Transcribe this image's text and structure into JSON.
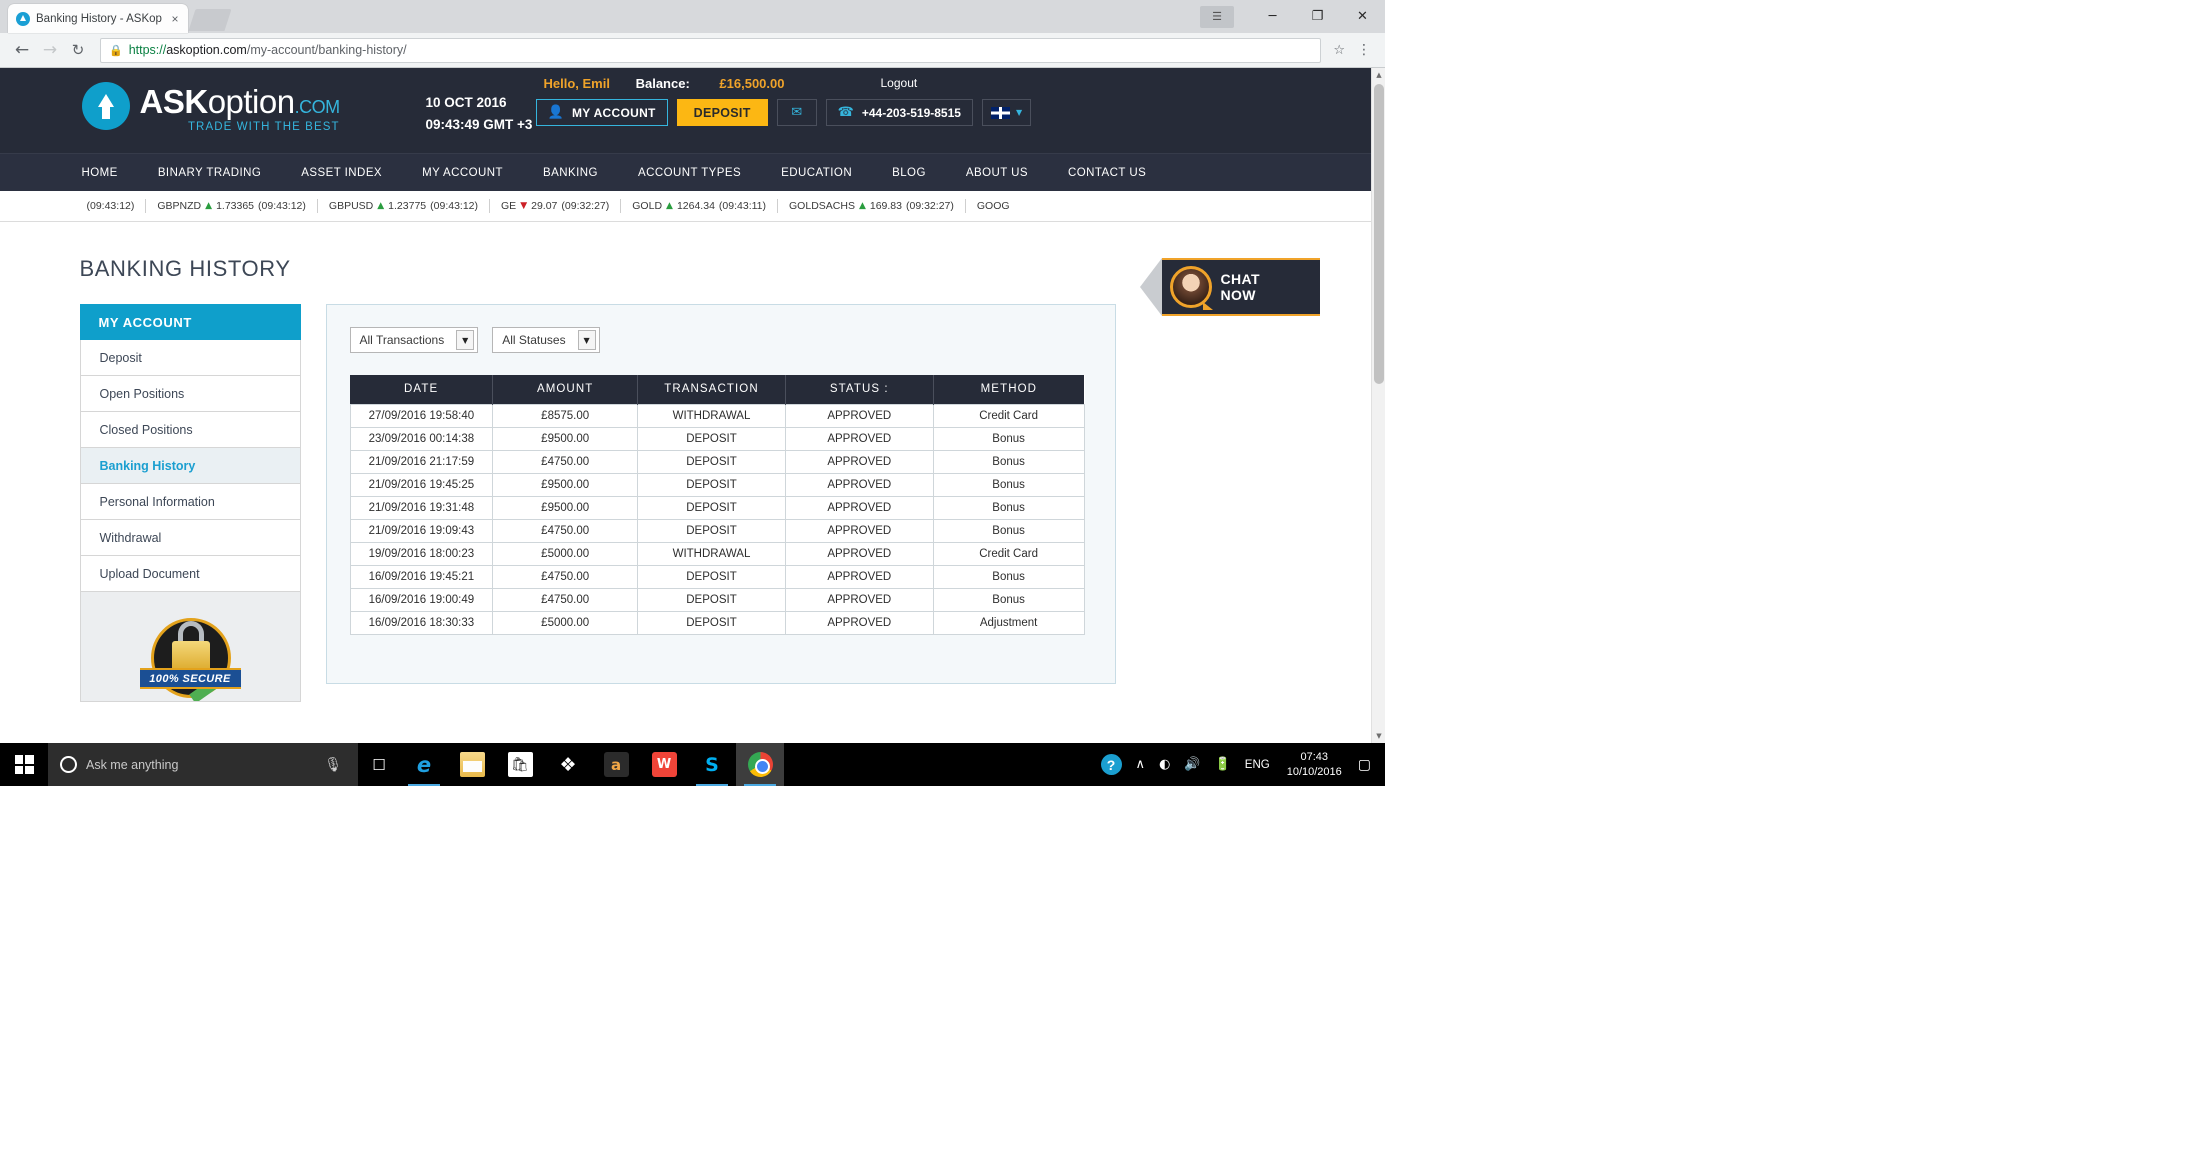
{
  "browser": {
    "tab": {
      "title": "Banking History - ASKop",
      "favicon": "askoption-favicon",
      "close": "×"
    },
    "window_controls": {
      "restore_small": "☰",
      "minimize": "─",
      "maximize": "❐",
      "close": "✕"
    },
    "nav": {
      "back": "←",
      "forward": "→",
      "reload": "↻",
      "star": "☆",
      "menu": "⋮"
    },
    "url": {
      "lock": "🔒",
      "scheme": "https://",
      "host": "askoption.com",
      "path": "/my-account/banking-history/"
    },
    "scrollbar": {
      "up": "▲",
      "down": "▼"
    }
  },
  "site": {
    "logo": {
      "ask": "ASK",
      "option": "option",
      "dotcom": ".COM",
      "tagline": "TRADE WITH THE BEST"
    },
    "date_line1": "10 OCT 2016",
    "date_line2": "09:43:49 GMT +3",
    "greeting": "Hello, Emil",
    "balance_label": "Balance:",
    "balance_value": "£16,500.00",
    "logout": "Logout",
    "buttons": {
      "my_account": "MY ACCOUNT",
      "deposit": "DEPOSIT",
      "mail_icon": "✉",
      "phone_icon": "☎",
      "phone": "+44-203-519-8515",
      "lang_caret": "▼"
    },
    "nav_items": [
      "HOME",
      "BINARY TRADING",
      "ASSET INDEX",
      "MY ACCOUNT",
      "BANKING",
      "ACCOUNT TYPES",
      "EDUCATION",
      "BLOG",
      "ABOUT US",
      "CONTACT US"
    ],
    "ticker": [
      {
        "symbol": "",
        "dir": "",
        "value": "",
        "time": "(09:43:12)"
      },
      {
        "symbol": "GBPNZD",
        "dir": "up",
        "value": "1.73365",
        "time": "(09:43:12)"
      },
      {
        "symbol": "GBPUSD",
        "dir": "up",
        "value": "1.23775",
        "time": "(09:43:12)"
      },
      {
        "symbol": "GE",
        "dir": "down",
        "value": "29.07",
        "time": "(09:32:27)"
      },
      {
        "symbol": "GOLD",
        "dir": "up",
        "value": "1264.34",
        "time": "(09:43:11)"
      },
      {
        "symbol": "GOLDSACHS",
        "dir": "up",
        "value": "169.83",
        "time": "(09:32:27)"
      },
      {
        "symbol": "GOOG",
        "dir": "",
        "value": "",
        "time": ""
      }
    ],
    "arrow_up": "▲",
    "arrow_down": "▼"
  },
  "page": {
    "title": "BANKING HISTORY",
    "sidebar": {
      "header": "MY ACCOUNT",
      "items": [
        {
          "label": "Deposit",
          "active": false
        },
        {
          "label": "Open Positions",
          "active": false
        },
        {
          "label": "Closed Positions",
          "active": false
        },
        {
          "label": "Banking History",
          "active": true
        },
        {
          "label": "Personal Information",
          "active": false
        },
        {
          "label": "Withdrawal",
          "active": false
        },
        {
          "label": "Upload Document",
          "active": false
        }
      ],
      "secure_badge": "100% SECURE"
    },
    "filters": {
      "transactions": {
        "value": "All Transactions",
        "caret": "▼"
      },
      "statuses": {
        "value": "All Statuses",
        "caret": "▼"
      }
    },
    "table": {
      "columns": [
        "DATE",
        "AMOUNT",
        "TRANSACTION",
        "STATUS :",
        "METHOD"
      ],
      "rows": [
        [
          "27/09/2016 19:58:40",
          "£8575.00",
          "WITHDRAWAL",
          "APPROVED",
          "Credit Card"
        ],
        [
          "23/09/2016 00:14:38",
          "£9500.00",
          "DEPOSIT",
          "APPROVED",
          "Bonus"
        ],
        [
          "21/09/2016 21:17:59",
          "£4750.00",
          "DEPOSIT",
          "APPROVED",
          "Bonus"
        ],
        [
          "21/09/2016 19:45:25",
          "£9500.00",
          "DEPOSIT",
          "APPROVED",
          "Bonus"
        ],
        [
          "21/09/2016 19:31:48",
          "£9500.00",
          "DEPOSIT",
          "APPROVED",
          "Bonus"
        ],
        [
          "21/09/2016 19:09:43",
          "£4750.00",
          "DEPOSIT",
          "APPROVED",
          "Bonus"
        ],
        [
          "19/09/2016 18:00:23",
          "£5000.00",
          "WITHDRAWAL",
          "APPROVED",
          "Credit Card"
        ],
        [
          "16/09/2016 19:45:21",
          "£4750.00",
          "DEPOSIT",
          "APPROVED",
          "Bonus"
        ],
        [
          "16/09/2016 19:00:49",
          "£4750.00",
          "DEPOSIT",
          "APPROVED",
          "Bonus"
        ],
        [
          "16/09/2016 18:30:33",
          "£5000.00",
          "DEPOSIT",
          "APPROVED",
          "Adjustment"
        ]
      ]
    },
    "chat": {
      "line1": "CHAT",
      "line2": "NOW"
    }
  },
  "taskbar": {
    "search_placeholder": "Ask me anything",
    "mic_icon": "🎙",
    "task_view_icon": "❐",
    "apps": [
      {
        "name": "edge",
        "glyph": "e",
        "running": true,
        "active": false
      },
      {
        "name": "file-explorer",
        "glyph": "",
        "running": false,
        "active": false
      },
      {
        "name": "store",
        "glyph": "🛍",
        "running": false,
        "active": false
      },
      {
        "name": "dropbox",
        "glyph": "❖",
        "running": false,
        "active": false
      },
      {
        "name": "amazon",
        "glyph": "a",
        "running": false,
        "active": false
      },
      {
        "name": "wps-office",
        "glyph": "W",
        "running": false,
        "active": false
      },
      {
        "name": "skype",
        "glyph": "S",
        "running": true,
        "active": false
      },
      {
        "name": "chrome",
        "glyph": "",
        "running": true,
        "active": true
      }
    ],
    "tray": {
      "help": "?",
      "chevron": "∧",
      "wifi": "◠",
      "volume": "🔊",
      "battery": "🔋",
      "language": "ENG",
      "time": "07:43",
      "date": "10/10/2016",
      "notifications": "▢"
    }
  }
}
